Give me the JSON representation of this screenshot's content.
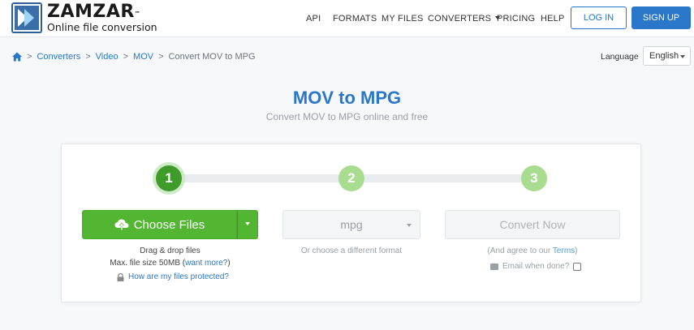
{
  "header": {
    "logo_name": "ZAMZAR",
    "logo_tm": "™",
    "logo_tagline": "Online file conversion",
    "nav": {
      "api": "API",
      "formats": "FORMATS",
      "my_files": "MY FILES",
      "converters": "CONVERTERS",
      "pricing": "PRICING",
      "help": "HELP"
    },
    "login": "LOG IN",
    "signup": "SIGN UP"
  },
  "breadcrumb": {
    "sep": ">",
    "items": [
      "Converters",
      "Video",
      "MOV"
    ],
    "current": "Convert MOV to MPG"
  },
  "language": {
    "label": "Language",
    "selected": "English"
  },
  "page": {
    "title": "MOV to MPG",
    "subtitle": "Convert MOV to MPG online and free"
  },
  "converter": {
    "steps": [
      "1",
      "2",
      "3"
    ],
    "active_step": 1,
    "choose_files": "Choose Files",
    "drag_drop": "Drag & drop files",
    "max_size": "Max. file size 50MB (",
    "want_more": "want more?",
    "max_size_close": ")",
    "protected": "How are my files protected?",
    "format_value": "mpg",
    "format_hint": "Or choose a different format",
    "convert_now": "Convert Now",
    "agree_pre": "(And agree to our ",
    "terms": "Terms",
    "agree_post": ")",
    "email_when_done": "Email when done?"
  },
  "colors": {
    "brand_blue": "#2a77c9",
    "green": "#52b632",
    "step_inactive": "#a8dc8f"
  }
}
